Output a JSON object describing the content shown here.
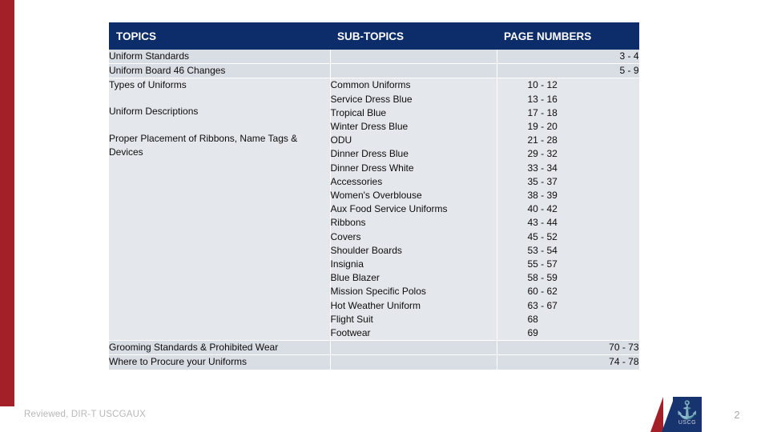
{
  "document": {
    "footer_note": "Reviewed, DIR-T USCGAUX",
    "page_number": "2",
    "emblem": {
      "glyph": "⚓",
      "caption": "USCG"
    }
  },
  "table": {
    "headers": {
      "topics": "TOPICS",
      "subtopics": "SUB-TOPICS",
      "pages": "PAGE NUMBERS"
    },
    "rows": [
      {
        "topic": "Uniform Standards",
        "subtopic": "",
        "pages": "3 -  4"
      },
      {
        "topic": "Uniform Board 46 Changes",
        "subtopic": "",
        "pages": "5 -  9"
      }
    ],
    "main_block": {
      "topics": [
        "Types of Uniforms",
        "Uniform Descriptions",
        "Proper Placement of Ribbons, Name Tags & Devices"
      ],
      "subtopics": [
        "Common Uniforms",
        "Service Dress Blue",
        "Tropical Blue",
        "Winter Dress Blue",
        "ODU",
        "Dinner Dress Blue",
        "Dinner Dress White",
        "Accessories",
        "Women's Overblouse",
        "Aux Food Service Uniforms",
        "Ribbons",
        "Covers",
        "Shoulder Boards",
        "Insignia",
        "Blue Blazer",
        "Mission Specific Polos",
        "Hot Weather Uniform",
        "Flight Suit",
        "Footwear"
      ],
      "pages": [
        "10 - 12",
        "13 - 16",
        "17 - 18",
        "19 - 20",
        "21 - 28",
        "29 - 32",
        "33 - 34",
        "35 - 37",
        "38 - 39",
        "40 - 42",
        "43 - 44",
        "45 - 52",
        "53 - 54",
        "55 - 57",
        "58 - 59",
        "60 - 62",
        "63 - 67",
        "68",
        "69"
      ]
    },
    "rows_bottom": [
      {
        "topic": "Grooming Standards & Prohibited Wear",
        "subtopic": "",
        "pages": "70 - 73"
      },
      {
        "topic": "Where to Procure your Uniforms",
        "subtopic": "",
        "pages": "74 - 78"
      }
    ]
  }
}
